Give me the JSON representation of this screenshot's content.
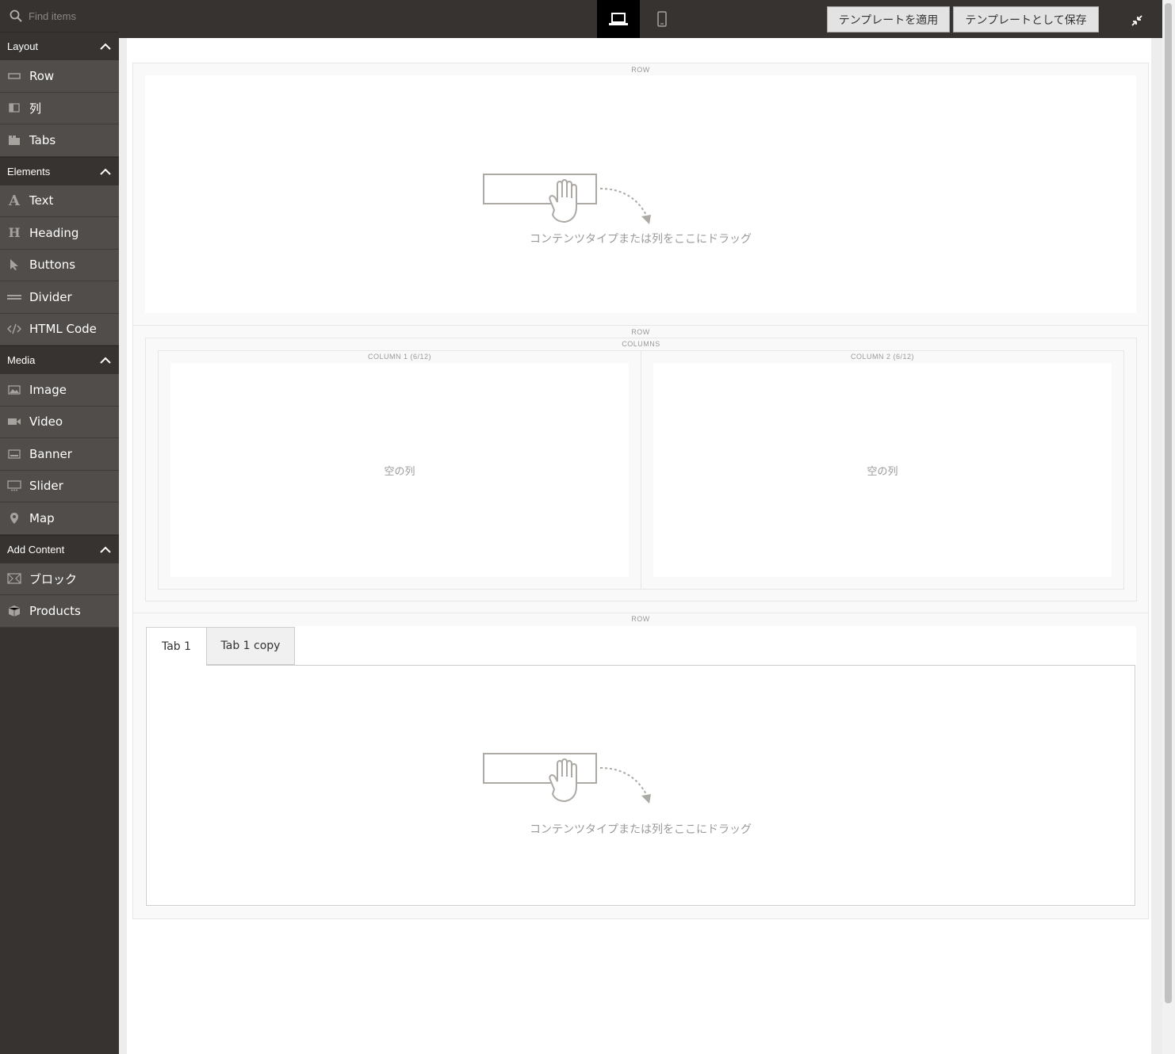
{
  "search": {
    "placeholder": "Find items"
  },
  "toolbar": {
    "apply_template": "テンプレートを適用",
    "save_template": "テンプレートとして保存"
  },
  "sidebar": {
    "sections": [
      {
        "title": "Layout",
        "items": [
          "Row",
          "列",
          "Tabs"
        ]
      },
      {
        "title": "Elements",
        "items": [
          "Text",
          "Heading",
          "Buttons",
          "Divider",
          "HTML Code"
        ]
      },
      {
        "title": "Media",
        "items": [
          "Image",
          "Video",
          "Banner",
          "Slider",
          "Map"
        ]
      },
      {
        "title": "Add Content",
        "items": [
          "ブロック",
          "Products"
        ]
      }
    ]
  },
  "stage": {
    "row_label": "ROW",
    "columns_label": "COLUMNS",
    "column1_label": "COLUMN 1 (6/12)",
    "column2_label": "COLUMN 2 (6/12)",
    "drop_text": "コンテンツタイプまたは列をここにドラッグ",
    "empty_column": "空の列",
    "tabs": [
      "Tab 1",
      "Tab 1 copy"
    ]
  }
}
